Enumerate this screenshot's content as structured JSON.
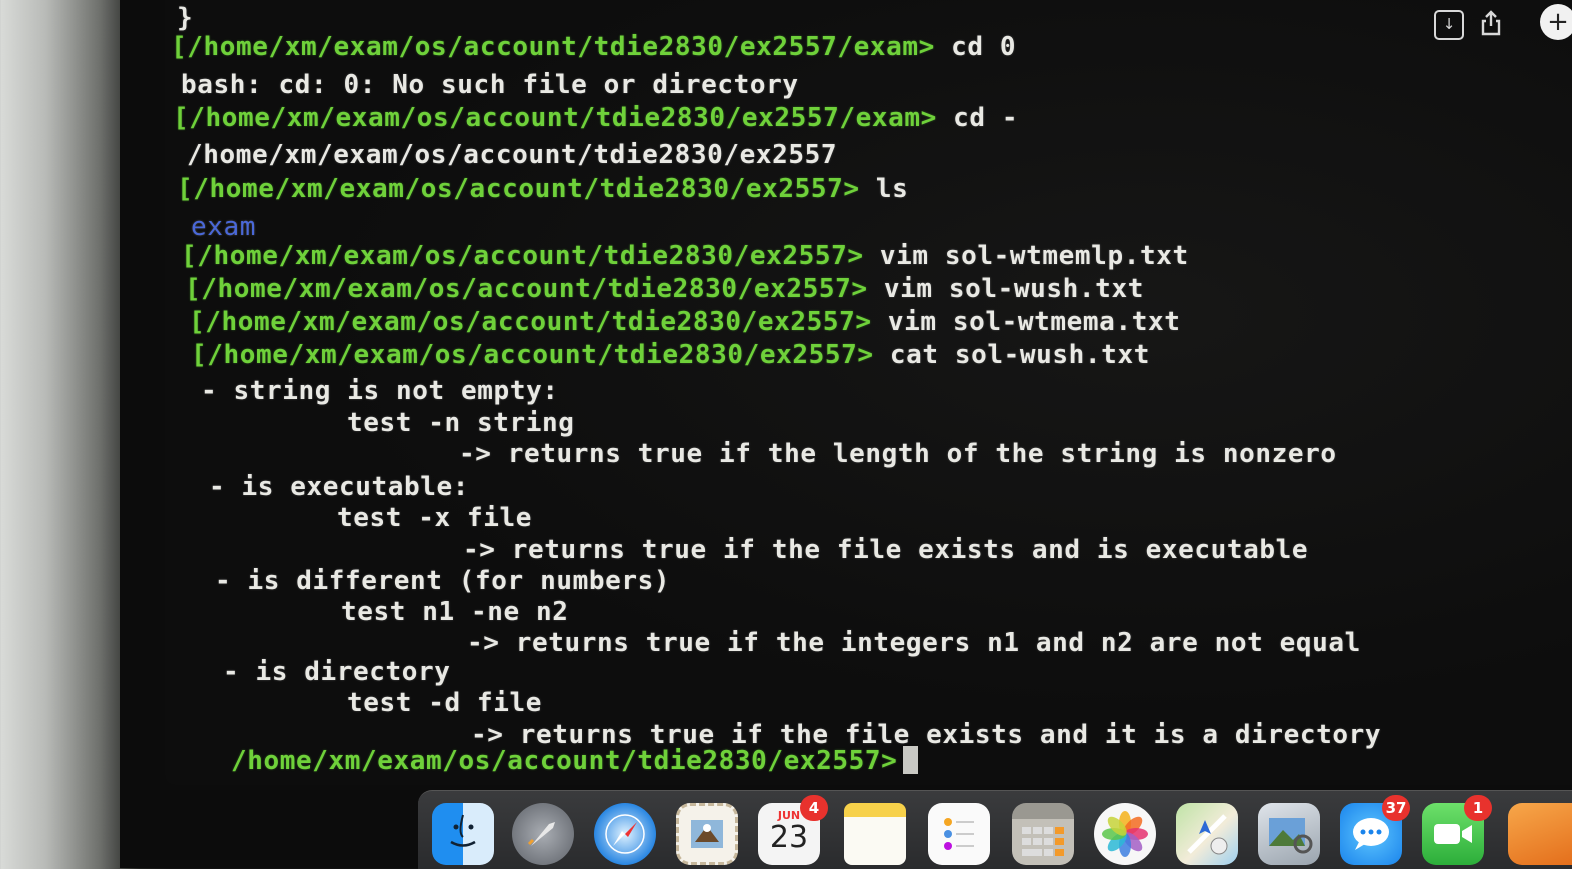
{
  "terminal": {
    "lines": {
      "l0": {
        "text": "}"
      },
      "l1": {
        "prompt": "[/home/xm/exam/os/account/tdie2830/ex2557/exam>",
        "cmd": " cd 0"
      },
      "l2": {
        "text": "bash: cd: 0: No such file or directory"
      },
      "l3": {
        "prompt": "[/home/xm/exam/os/account/tdie2830/ex2557/exam>",
        "cmd": " cd -"
      },
      "l4": {
        "text": "/home/xm/exam/os/account/tdie2830/ex2557"
      },
      "l5": {
        "prompt": "[/home/xm/exam/os/account/tdie2830/ex2557>",
        "cmd": " ls"
      },
      "l6": {
        "text": "exam"
      },
      "l7": {
        "prompt": "[/home/xm/exam/os/account/tdie2830/ex2557>",
        "cmd": " vim sol-wtmemlp.txt"
      },
      "l8": {
        "prompt": "[/home/xm/exam/os/account/tdie2830/ex2557>",
        "cmd": " vim sol-wush.txt"
      },
      "l9": {
        "prompt": "[/home/xm/exam/os/account/tdie2830/ex2557>",
        "cmd": " vim sol-wtmema.txt"
      },
      "l10": {
        "prompt": "[/home/xm/exam/os/account/tdie2830/ex2557>",
        "cmd": " cat sol-wush.txt"
      },
      "l11": {
        "text": "- string is not empty:"
      },
      "l12": {
        "text": "test -n string"
      },
      "l13": {
        "text": "-> returns true if the length of the string is nonzero"
      },
      "l14": {
        "text": "- is executable:"
      },
      "l15": {
        "text": "test -x file"
      },
      "l16": {
        "text": "-> returns true if the file exists and is executable"
      },
      "l17": {
        "text": "- is different (for numbers)"
      },
      "l18": {
        "text": "test n1 -ne n2"
      },
      "l19": {
        "text": "-> returns true if the integers n1 and n2 are not equal"
      },
      "l20": {
        "text": "- is directory"
      },
      "l21": {
        "text": "test -d file"
      },
      "l22": {
        "text": "-> returns true if the file exists and it is a directory"
      },
      "l23": {
        "prompt": "/home/xm/exam/os/account/tdie2830/ex2557>"
      }
    }
  },
  "colors": {
    "prompt": "#6fd13a",
    "output": "#e9e9e4",
    "directory": "#4a68d8",
    "background": "#0d0d0d"
  },
  "dock": {
    "calendar": {
      "month": "JUN",
      "day": "23",
      "badge": "4"
    },
    "messages": {
      "badge": "37"
    },
    "facetime": {
      "badge": "1"
    }
  },
  "icons": [
    "finder-icon",
    "launchpad-icon",
    "safari-icon",
    "mail-icon",
    "calendar-icon",
    "notes-icon",
    "reminders-icon",
    "calculator-icon",
    "photos-icon",
    "maps-icon",
    "preview-icon",
    "messages-icon",
    "facetime-icon",
    "pages-icon",
    "save-icon",
    "share-icon",
    "plus-icon"
  ]
}
